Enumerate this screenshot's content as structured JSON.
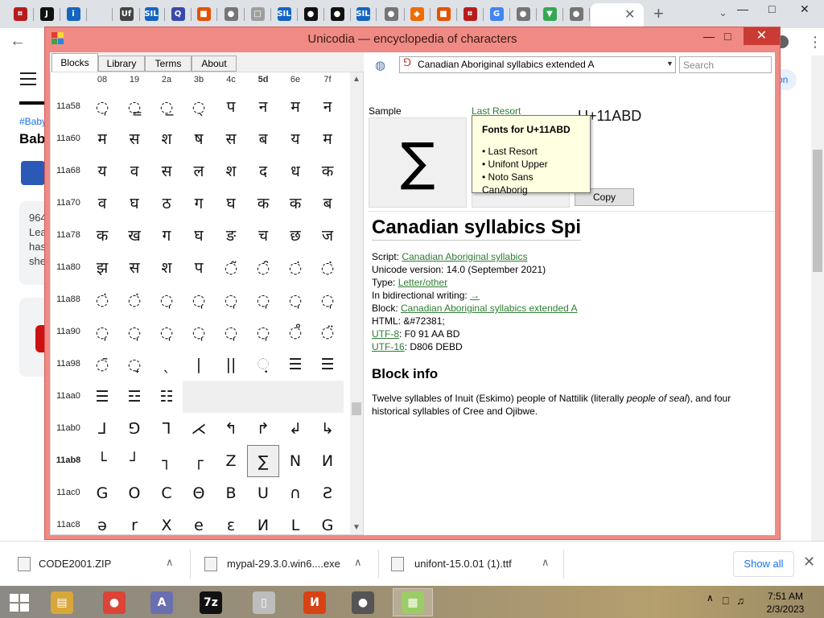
{
  "browser": {
    "tabs": [
      {
        "icon": "sil-app-icon",
        "glyph": "⌗",
        "color": "#b71c1c"
      },
      {
        "icon": "dark-app-icon",
        "glyph": "J",
        "color": "#111111"
      },
      {
        "icon": "info-icon",
        "glyph": "i",
        "color": "#1565c0"
      },
      {
        "icon": "blank-icon",
        "glyph": "",
        "color": "#dee1e6"
      },
      {
        "icon": "uf-icon",
        "glyph": "Uf",
        "color": "#444444"
      },
      {
        "icon": "sil-icon",
        "glyph": "SIL",
        "color": "#1565c0"
      },
      {
        "icon": "q-icon",
        "glyph": "Q",
        "color": "#3949ab"
      },
      {
        "icon": "puzzle-icon",
        "glyph": "■",
        "color": "#e65100"
      },
      {
        "icon": "globe-icon",
        "glyph": "●",
        "color": "#757575"
      },
      {
        "icon": "page-icon",
        "glyph": "□",
        "color": "#9e9e9e"
      },
      {
        "icon": "sil-icon",
        "glyph": "SIL",
        "color": "#1565c0"
      },
      {
        "icon": "dark-circle-icon",
        "glyph": "●",
        "color": "#111111"
      },
      {
        "icon": "dark-circle-icon",
        "glyph": "●",
        "color": "#111111"
      },
      {
        "icon": "sil-icon",
        "glyph": "SIL",
        "color": "#1565c0"
      },
      {
        "icon": "globe-icon",
        "glyph": "●",
        "color": "#757575"
      },
      {
        "icon": "diamond-icon",
        "glyph": "◆",
        "color": "#ef6c00"
      },
      {
        "icon": "puzzle-icon",
        "glyph": "■",
        "color": "#e65100"
      },
      {
        "icon": "sil-app-icon",
        "glyph": "⌗",
        "color": "#b71c1c"
      },
      {
        "icon": "google-icon",
        "glyph": "G",
        "color": "#4285f4"
      },
      {
        "icon": "globe-icon",
        "glyph": "●",
        "color": "#757575"
      },
      {
        "icon": "maps-pin-icon",
        "glyph": "▼",
        "color": "#34a853"
      },
      {
        "icon": "globe-icon",
        "glyph": "●",
        "color": "#757575"
      },
      {
        "icon": "chrome-icon",
        "glyph": "●",
        "color": "#5f6368"
      }
    ],
    "close_tab": "✕",
    "new_tab": "+",
    "tab_search": "⌄",
    "min": "—",
    "max": "□",
    "close": "✕",
    "back": "←",
    "menu": "⋮"
  },
  "bg_page": {
    "tag": "#Baby",
    "title": "Bab",
    "card_text": "964 Lea has she",
    "pill": "on"
  },
  "window": {
    "title": "Unicodia — encyclopedia of characters",
    "min": "—",
    "max": "□",
    "close": "✕"
  },
  "tabs": [
    {
      "label": "Blocks",
      "active": true
    },
    {
      "label": "Library",
      "active": false
    },
    {
      "label": "Terms",
      "active": false
    },
    {
      "label": "About",
      "active": false
    }
  ],
  "grid": {
    "columns": [
      "08",
      "19",
      "2a",
      "3b",
      "4c",
      "5d",
      "6e",
      "7f"
    ],
    "selected_column": "5d",
    "rows": [
      {
        "label": "11a58",
        "cells": [
          "◌̩",
          "◌̳",
          "◌̲",
          "◌̖",
          "प",
          "न",
          "म",
          "न"
        ]
      },
      {
        "label": "11a60",
        "cells": [
          "म",
          "स",
          "श",
          "ष",
          "स",
          "ब",
          "य",
          "म"
        ]
      },
      {
        "label": "11a68",
        "cells": [
          "य",
          "व",
          "स",
          "ल",
          "श",
          "द",
          "ध",
          "क"
        ]
      },
      {
        "label": "11a70",
        "cells": [
          "व",
          "घ",
          "ठ",
          "ग",
          "घ",
          "क",
          "क",
          "ब"
        ]
      },
      {
        "label": "11a78",
        "cells": [
          "क",
          "ख",
          "ग",
          "घ",
          "ङ",
          "च",
          "छ",
          "ज"
        ]
      },
      {
        "label": "11a80",
        "cells": [
          "झ",
          "स",
          "श",
          "प",
          "◌̃",
          "◌̑",
          "◌̇",
          "◌̇"
        ]
      },
      {
        "label": "11a88",
        "cells": [
          "◌̇",
          "◌̇",
          "◌̩",
          "◌̩",
          "◌̩",
          "◌̩",
          "◌̩",
          "◌̩"
        ]
      },
      {
        "label": "11a90",
        "cells": [
          "◌̩",
          "◌̩",
          "◌̩",
          "◌̩",
          "◌̩",
          "◌̩",
          "◌̊",
          "◌̈"
        ]
      },
      {
        "label": "11a98",
        "cells": [
          "◌̄",
          "◌̟",
          "ˎ",
          "|",
          "||",
          "଼",
          "☰",
          "☰"
        ]
      },
      {
        "label": "11aa0",
        "cells": [
          "☰",
          "☲",
          "☷",
          "",
          "",
          "",
          "",
          ""
        ]
      },
      {
        "label": "11ab0",
        "cells": [
          "⅃",
          "⅁",
          "⅂",
          "⋌",
          "↰",
          "↱",
          "↲",
          "↳"
        ]
      },
      {
        "label": "11ab8",
        "cells": [
          "└",
          "┘",
          "┐",
          "┌",
          "Z",
          "∑",
          "N",
          "И"
        ]
      },
      {
        "label": "11ac0",
        "cells": [
          "G",
          "O",
          "C",
          "Θ",
          "B",
          "U",
          "∩",
          "Ƨ"
        ]
      },
      {
        "label": "11ac8",
        "cells": [
          "ə",
          "r",
          "X",
          "e",
          "ɛ",
          "И",
          "L",
          "G"
        ]
      }
    ],
    "selected_row": "11ab8",
    "current_cell": {
      "row": 11,
      "col": 5
    }
  },
  "panel": {
    "block_select": "Canadian Aboriginal syllabics extended A",
    "block_glyph": "⅁",
    "search_placeholder": "Search",
    "sample_label": "Sample",
    "sample_glyph": "∑",
    "font_link": "Last Resort",
    "code": "U+11ABD",
    "copy_label": "Copy",
    "tooltip": {
      "title": "Fonts for U+11ABD",
      "items": [
        "• Last Resort",
        "• Unifont Upper",
        "• Noto Sans CanAborig"
      ]
    },
    "char_name": "Canadian syllabics Spi",
    "props": {
      "script_label": "Script: ",
      "script_value": "Canadian Aboriginal syllabics",
      "version": "Unicode version: 14.0 (September 2021)",
      "type_label": "Type: ",
      "type_value": "Letter/other",
      "bidi_label": "In bidirectional writing: ",
      "bidi_value": "→",
      "block_label": "Block: ",
      "block_value": "Canadian Aboriginal syllabics extended A",
      "html": "HTML: &#72381;",
      "utf8_label": "UTF-8",
      "utf8_value": ": F0 91 AA BD",
      "utf16_label": "UTF-16",
      "utf16_value": ": D806 DEBD"
    },
    "block_info_title": "Block info",
    "block_desc_pre": "Twelve syllables of Inuit (Eskimo) people of Nattilik (literally ",
    "block_desc_em": "people of seal",
    "block_desc_post": "), and four historical syllables of Cree and Ojibwe."
  },
  "downloads": {
    "items": [
      {
        "name": "CODE2001.ZIP"
      },
      {
        "name": "mypal-29.3.0.win6....exe"
      },
      {
        "name": "unifont-15.0.01 (1).ttf"
      }
    ],
    "chevron": "∧",
    "show_all": "Show all",
    "close": "✕"
  },
  "taskbar": {
    "apps": [
      {
        "icon": "file-explorer-icon",
        "glyph": "▤",
        "color": "#d8a73a"
      },
      {
        "icon": "chrome-icon",
        "glyph": "●",
        "color": "#db4437"
      },
      {
        "icon": "font-app-icon",
        "glyph": "A",
        "color": "#6a6fb0"
      },
      {
        "icon": "7zip-icon",
        "glyph": "7z",
        "color": "#111111"
      },
      {
        "icon": "document-icon",
        "glyph": "▯",
        "color": "#bdbdbd"
      },
      {
        "icon": "app-icon",
        "glyph": "И",
        "color": "#d84315"
      },
      {
        "icon": "raccoon-icon",
        "glyph": "●",
        "color": "#555555"
      },
      {
        "icon": "unicodia-icon",
        "glyph": "▦",
        "color": "#9ccc65"
      }
    ],
    "time": "7:51 AM",
    "date": "2/3/2023",
    "tray_up": "∧",
    "tray_icons": "⎕ ♫"
  }
}
